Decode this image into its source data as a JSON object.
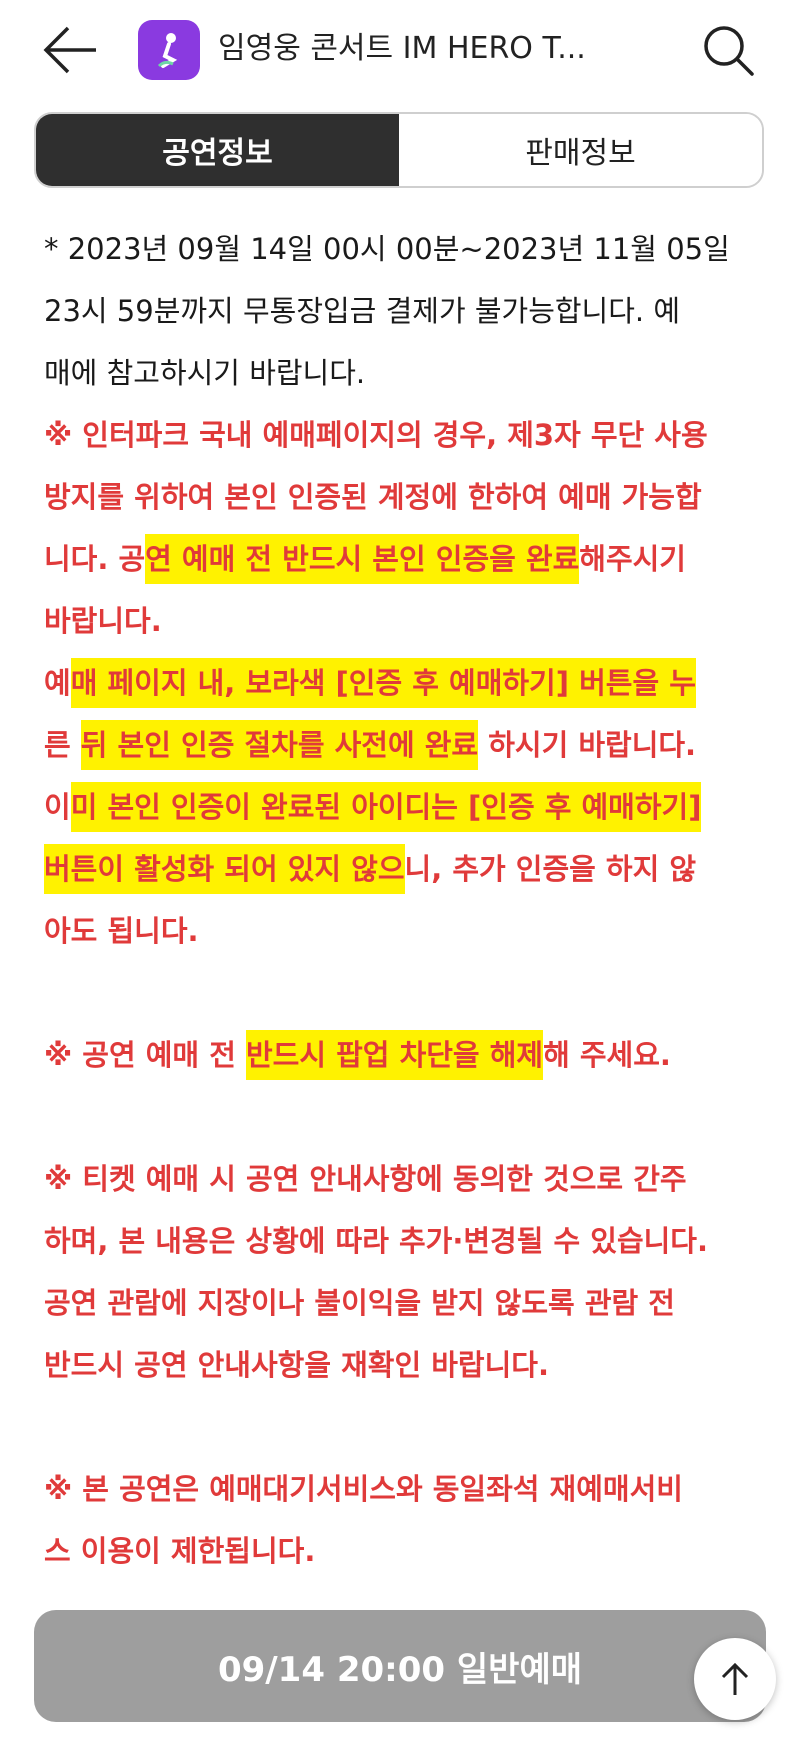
{
  "header": {
    "title": "임영웅 콘서트 IM HERO T...",
    "logo_color": "#8a3ae0"
  },
  "tabs": [
    {
      "label": "공연정보",
      "active": true
    },
    {
      "label": "판매정보",
      "active": false
    }
  ],
  "notice": {
    "p1": [
      "* 2023년 09월 14일 00시 00분~2023년 11월 05일",
      "23시 59분까지 무통장입금 결제가 불가능합니다. 예",
      "매에 참고하시기 바랍니다."
    ],
    "p2": {
      "l1": "※ 인터파크 국내 예매페이지의 경우, 제3자 무단 사용",
      "l2": "방지를 위하여 본인 인증된 계정에 한하여 예매 가능합",
      "l3a": "니다. 공",
      "l3b": "연 예매 전 반드시 본인 인증을 완료",
      "l3c": "해주시기",
      "l4": "바랍니다."
    },
    "p3": {
      "l1a": "예",
      "l1b": "매 페이지 내, 보라색 [인증 후 예매하기] 버튼을 누",
      "l2a": "른 ",
      "l2b": "뒤 본인 인증 절차를 사전에 완료",
      "l2c": " 하시기 바랍니다.",
      "l3a": "이",
      "l3b": "미 본인 인증이 완료된 아이디는 [인증 후 예매하기]",
      "l4a": "버튼이 활성화 되어 있지 않으",
      "l4b": "니, 추가 인증을 하지 않",
      "l5": "아도 됩니다."
    },
    "p4": {
      "a": "※ 공연 예매 전 ",
      "b": "반드시 팝업 차단을 해제",
      "c": "해 주세요."
    },
    "p5": [
      "※ 티켓 예매 시 공연 안내사항에 동의한 것으로 간주",
      "하며, 본 내용은 상황에 따라 추가·변경될 수 있습니다.",
      "공연 관람에 지장이나 불이익을 받지 않도록 관람 전",
      "반드시 공연 안내사항을 재확인 바랍니다."
    ],
    "p6": [
      "※ 본 공연은 예매대기서비스와 동일좌석 재예매서비",
      "스 이용이 제한됩니다."
    ]
  },
  "footer": {
    "button_label": "09/14 20:00 일반예매"
  },
  "icons": {
    "back": "arrow-left-icon",
    "search": "search-icon",
    "scroll_top": "arrow-up-icon"
  },
  "colors": {
    "notice_red": "#e03a3a",
    "highlight": "#fff200",
    "active_tab": "#2f2f2f",
    "button_gray": "#9e9e9e"
  }
}
